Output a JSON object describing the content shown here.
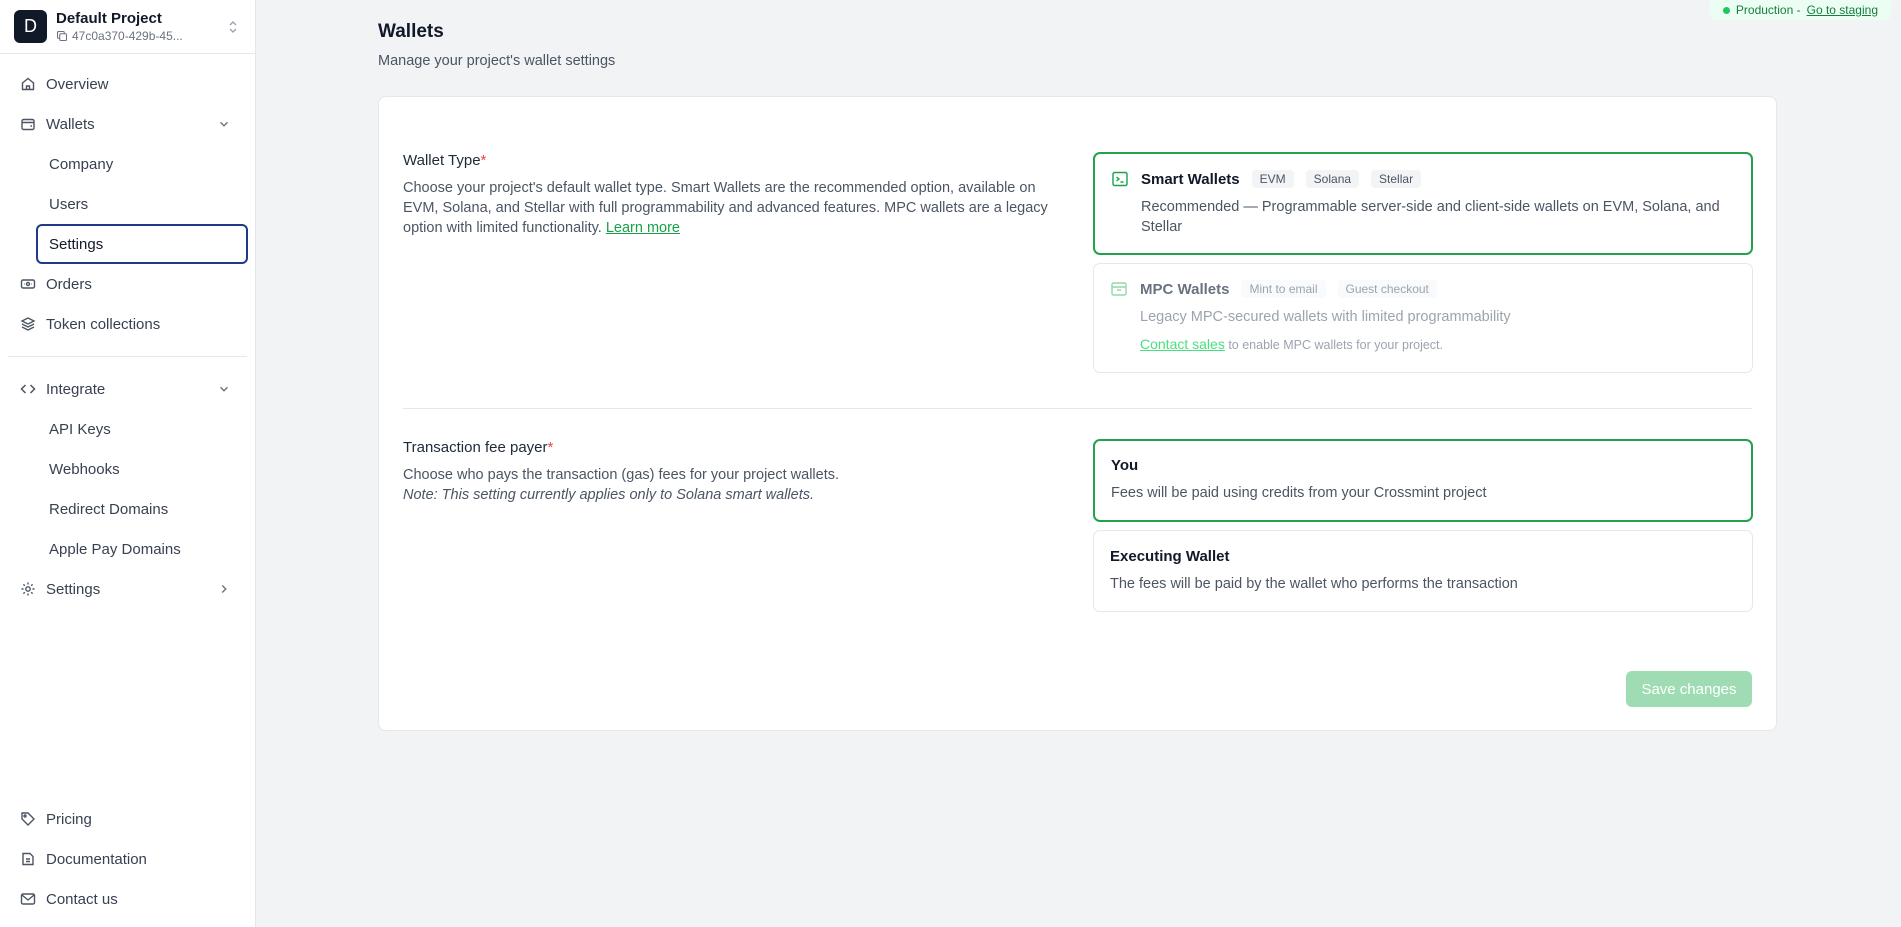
{
  "project": {
    "initial": "D",
    "name": "Default Project",
    "id": "47c0a370-429b-45..."
  },
  "nav": {
    "overview": "Overview",
    "wallets": "Wallets",
    "wallets_sub": [
      "Company",
      "Users",
      "Settings"
    ],
    "orders": "Orders",
    "token_collections": "Token collections",
    "integrate": "Integrate",
    "integrate_sub": [
      "API Keys",
      "Webhooks",
      "Redirect Domains",
      "Apple Pay Domains"
    ],
    "settings": "Settings",
    "bottom": [
      "Pricing",
      "Documentation",
      "Contact us"
    ]
  },
  "env": {
    "label": "Production -",
    "link": "Go to staging"
  },
  "page": {
    "title": "Wallets",
    "subtitle": "Manage your project's wallet settings"
  },
  "wallet_type": {
    "label": "Wallet Type",
    "required": "*",
    "description": "Choose your project's default wallet type. Smart Wallets are the recommended option, available on EVM, Solana, and Stellar with full programmability and advanced features. MPC wallets are a legacy option with limited functionality.",
    "learn_more": "Learn more",
    "options": [
      {
        "title": "Smart Wallets",
        "chips": [
          "EVM",
          "Solana",
          "Stellar"
        ],
        "description": "Recommended — Programmable server-side and client-side wallets on EVM, Solana, and Stellar",
        "selected": true
      },
      {
        "title": "MPC Wallets",
        "chips": [
          "Mint to email",
          "Guest checkout"
        ],
        "description": "Legacy MPC-secured wallets with limited programmability",
        "contact_link": "Contact sales",
        "contact_rest": "to enable MPC wallets for your project.",
        "selected": false
      }
    ]
  },
  "fee_payer": {
    "label": "Transaction fee payer",
    "required": "*",
    "description": "Choose who pays the transaction (gas) fees for your project wallets.",
    "note": "Note: This setting currently applies only to Solana smart wallets.",
    "options": [
      {
        "title": "You",
        "description": "Fees will be paid using credits from your Crossmint project",
        "selected": true
      },
      {
        "title": "Executing Wallet",
        "description": "The fees will be paid by the wallet who performs the transaction",
        "selected": false
      }
    ]
  },
  "actions": {
    "save": "Save changes"
  },
  "colors": {
    "accent": "#22a24a",
    "save_disabled": "#9fdcb4",
    "active_nav_border": "#1e3a8a"
  }
}
